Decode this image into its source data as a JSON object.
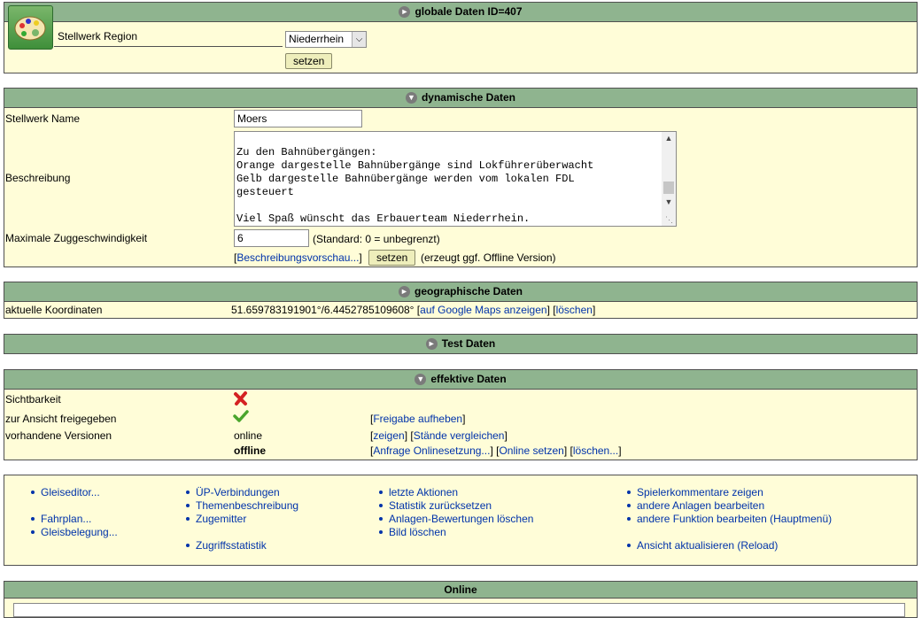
{
  "globale": {
    "header": "globale Daten ID=407",
    "region_label": "Stellwerk Region",
    "region_value": "Niederrhein",
    "submit": "setzen"
  },
  "dynamisch": {
    "header": "dynamische Daten",
    "name_label": "Stellwerk Name",
    "name_value": "Moers",
    "beschreibung_label": "Beschreibung",
    "beschreibung_text": "Zu den Bahnübergängen:\nOrange dargestelle Bahnübergänge sind Lokführerüberwacht\nGelb dargestelle Bahnübergänge werden vom lokalen FDL\ngesteuert\n\nViel Spaß wünscht das Erbauerteam Niederrhein.",
    "vmax_label": "Maximale Zuggeschwindigkeit",
    "vmax_value": "6",
    "vmax_hint": "(Standard: 0 = unbegrenzt)",
    "bracket_open": "[",
    "preview_link": "Beschreibungsvorschau...",
    "bracket_close": "]",
    "submit": "setzen",
    "offline_hint": "(erzeugt ggf. Offline Version)"
  },
  "geo": {
    "header": "geographische Daten",
    "koord_label": "aktuelle Koordinaten",
    "koord_value": "51.659783191901°/6.4452785109608°",
    "maps_link": "auf Google Maps anzeigen",
    "delete_link": "löschen"
  },
  "test": {
    "header": "Test Daten"
  },
  "effektiv": {
    "header": "effektive Daten",
    "sicht_label": "Sichtbarkeit",
    "freigabe_label": "zur Ansicht freigegeben",
    "freigabe_link": "Freigabe aufheben",
    "versionen_label": "vorhandene Versionen",
    "online_label": "online",
    "zeigen_link": "zeigen",
    "vergleich_link": "Stände vergleichen",
    "offline_label": "offline",
    "anfrage_link": "Anfrage Onlinesetzung...",
    "online_setzen_link": "Online setzen",
    "loeschen_link": "löschen..."
  },
  "menu": {
    "col1": [
      "Gleiseditor...",
      "",
      "Fahrplan...",
      "Gleisbelegung..."
    ],
    "col2": [
      "ÜP-Verbindungen",
      "Themenbeschreibung",
      "Zugemitter",
      "",
      "Zugriffsstatistik"
    ],
    "col3": [
      "letzte Aktionen",
      "Statistik zurücksetzen",
      "Anlagen-Bewertungen löschen",
      "Bild löschen"
    ],
    "col4": [
      "Spielerkommentare zeigen",
      "andere Anlagen bearbeiten",
      "andere Funktion bearbeiten (Hauptmenü)",
      "",
      "Ansicht aktualisieren (Reload)"
    ]
  },
  "online": {
    "header": "Online"
  },
  "colors": {
    "header_bg": "#8fb48f",
    "panel_bg": "#fffdd8",
    "link": "#0033aa"
  }
}
